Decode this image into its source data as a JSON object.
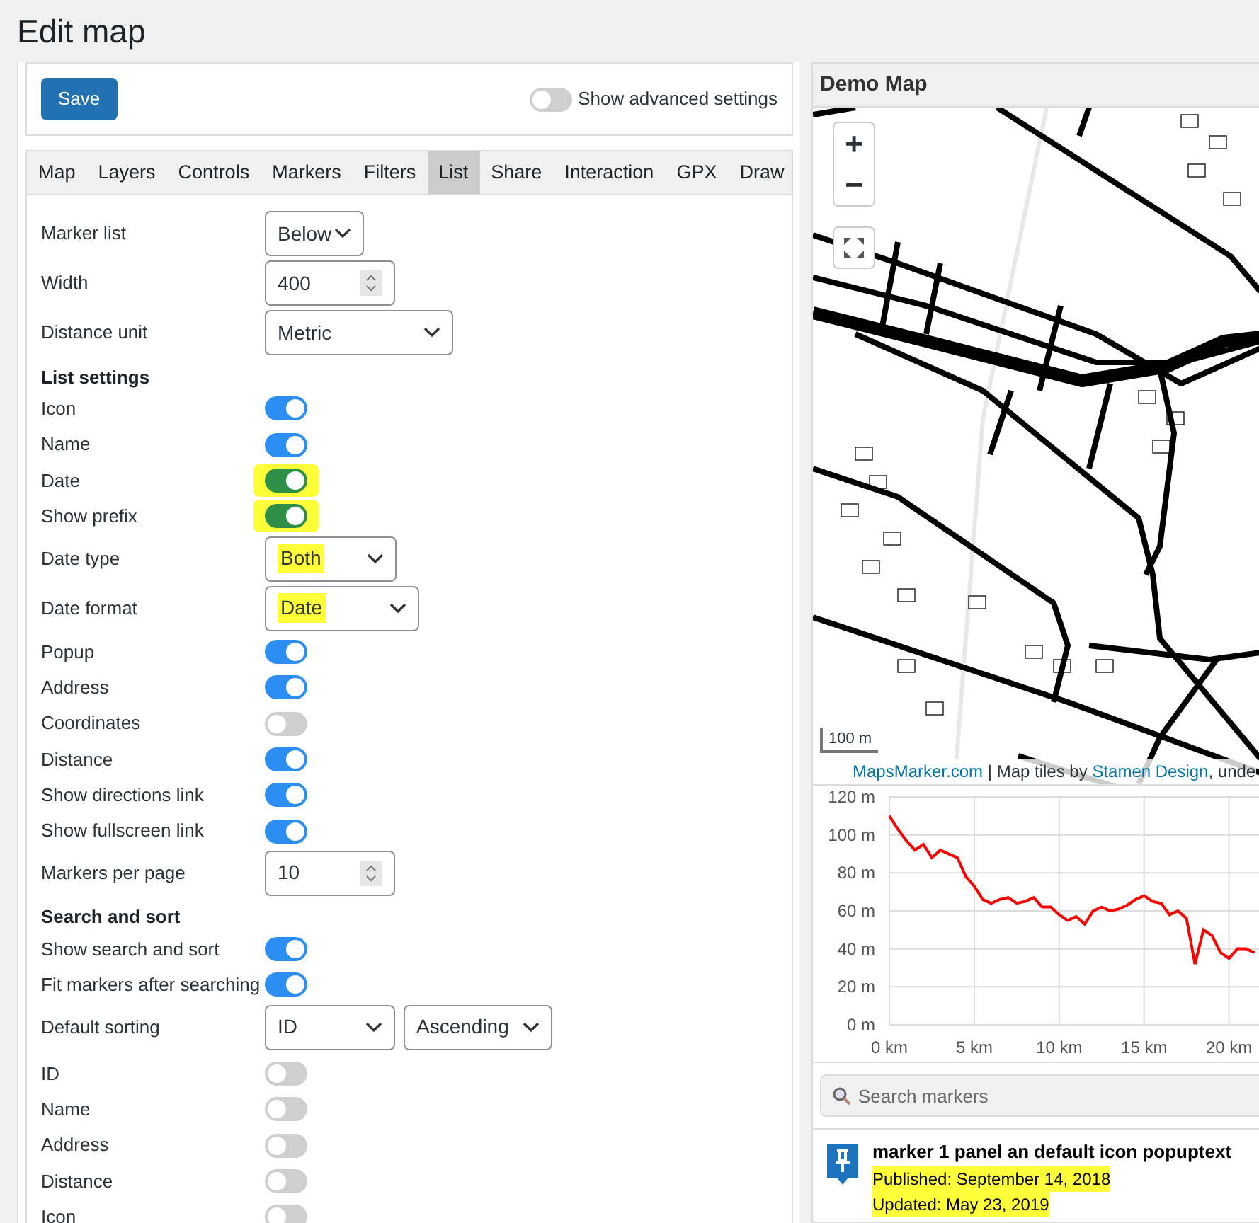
{
  "page": {
    "title": "Edit map"
  },
  "toolbar": {
    "save": "Save",
    "advanced": {
      "label": "Show advanced settings",
      "on": false
    }
  },
  "tabs": [
    {
      "label": "Map",
      "selected": false
    },
    {
      "label": "Layers",
      "selected": false
    },
    {
      "label": "Controls",
      "selected": false
    },
    {
      "label": "Markers",
      "selected": false
    },
    {
      "label": "Filters",
      "selected": false
    },
    {
      "label": "List",
      "selected": true
    },
    {
      "label": "Share",
      "selected": false
    },
    {
      "label": "Interaction",
      "selected": false
    },
    {
      "label": "GPX",
      "selected": false
    },
    {
      "label": "Draw",
      "selected": false
    }
  ],
  "settings": [
    {
      "kind": "select",
      "label": "Marker list",
      "value": "Below",
      "highlighted": false
    },
    {
      "kind": "number",
      "label": "Width",
      "value": "400"
    },
    {
      "kind": "select",
      "label": "Distance unit",
      "value": "Metric",
      "highlighted": false
    },
    {
      "kind": "heading",
      "label": "List settings"
    },
    {
      "kind": "toggle",
      "label": "Icon",
      "on": true,
      "highlighted": false
    },
    {
      "kind": "toggle",
      "label": "Name",
      "on": true,
      "highlighted": false
    },
    {
      "kind": "toggle",
      "label": "Date",
      "on": true,
      "highlighted": true
    },
    {
      "kind": "toggle",
      "label": "Show prefix",
      "on": true,
      "highlighted": true
    },
    {
      "kind": "select",
      "label": "Date type",
      "value": "Both",
      "highlighted": true
    },
    {
      "kind": "select",
      "label": "Date format",
      "value": "Date",
      "highlighted": true
    },
    {
      "kind": "toggle",
      "label": "Popup",
      "on": true,
      "highlighted": false
    },
    {
      "kind": "toggle",
      "label": "Address",
      "on": true,
      "highlighted": false
    },
    {
      "kind": "toggle",
      "label": "Coordinates",
      "on": false,
      "highlighted": false
    },
    {
      "kind": "toggle",
      "label": "Distance",
      "on": true,
      "highlighted": false
    },
    {
      "kind": "toggle",
      "label": "Show directions link",
      "on": true,
      "highlighted": false
    },
    {
      "kind": "toggle",
      "label": "Show fullscreen link",
      "on": true,
      "highlighted": false
    },
    {
      "kind": "number",
      "label": "Markers per page",
      "value": "10"
    },
    {
      "kind": "heading",
      "label": "Search and sort"
    },
    {
      "kind": "toggle",
      "label": "Show search and sort",
      "on": true,
      "highlighted": false
    },
    {
      "kind": "toggle",
      "label": "Fit markers after searching",
      "on": true,
      "highlighted": false
    },
    {
      "kind": "select2",
      "label": "Default sorting",
      "value": "ID",
      "value2": "Ascending"
    },
    {
      "kind": "toggle",
      "label": "ID",
      "on": false,
      "highlighted": false
    },
    {
      "kind": "toggle",
      "label": "Name",
      "on": false,
      "highlighted": false
    },
    {
      "kind": "toggle",
      "label": "Address",
      "on": false,
      "highlighted": false
    },
    {
      "kind": "toggle",
      "label": "Distance",
      "on": false,
      "highlighted": false
    },
    {
      "kind": "toggle",
      "label": "Icon",
      "on": false,
      "highlighted": false
    }
  ],
  "preview": {
    "title": "Demo Map",
    "zoom_in": "+",
    "zoom_out": "−",
    "scale": "100 m",
    "attribution": [
      {
        "text": "MapsMarker.com",
        "link": true
      },
      {
        "text": " | Map tiles by ",
        "link": false
      },
      {
        "text": "Stamen Design",
        "link": true
      },
      {
        "text": ", unde",
        "link": false
      }
    ],
    "chart_data": {
      "type": "line",
      "xlim": [
        0,
        21.85
      ],
      "ylim": [
        0,
        120
      ],
      "grid": true,
      "xticks": [
        {
          "value": 0,
          "label": "0 km"
        },
        {
          "value": 5,
          "label": "5 km"
        },
        {
          "value": 10,
          "label": "10 km"
        },
        {
          "value": 15,
          "label": "15 km"
        },
        {
          "value": 20,
          "label": "20 km"
        }
      ],
      "yticks": [
        {
          "value": 0,
          "label": "0 m"
        },
        {
          "value": 20,
          "label": "20 m"
        },
        {
          "value": 40,
          "label": "40 m"
        },
        {
          "value": 60,
          "label": "60 m"
        },
        {
          "value": 80,
          "label": "80 m"
        },
        {
          "value": 100,
          "label": "100 m"
        },
        {
          "value": 120,
          "label": "120 m"
        }
      ],
      "x": [
        0,
        0.5,
        1,
        1.5,
        2,
        2.5,
        3,
        3.5,
        4,
        4.5,
        5,
        5.5,
        6,
        6.5,
        7,
        7.5,
        8,
        8.5,
        9,
        9.5,
        10,
        10.5,
        11,
        11.5,
        12,
        12.5,
        13,
        13.5,
        14,
        14.5,
        15,
        15.5,
        16,
        16.5,
        17,
        17.5,
        18,
        18.5,
        19,
        19.5,
        20,
        20.5,
        21,
        21.5
      ],
      "series": [
        {
          "color": "#ff0000",
          "values": [
            110,
            103,
            97,
            92,
            95,
            88,
            92,
            90,
            88,
            78,
            73,
            66,
            64,
            66,
            67,
            64,
            65,
            67,
            62,
            62,
            58,
            55,
            57,
            53,
            60,
            62,
            60,
            61,
            63,
            66,
            68,
            65,
            64,
            58,
            60,
            56,
            32,
            50,
            47,
            38,
            35,
            40,
            40,
            38
          ]
        }
      ]
    },
    "search": {
      "placeholder": "Search markers"
    },
    "marker": {
      "name": "marker 1 panel an default icon popuptext",
      "lines": [
        {
          "text": "Published: September 14, 2018",
          "highlighted": true
        },
        {
          "text": "Updated: May 23, 2019",
          "highlighted": true
        }
      ]
    }
  }
}
